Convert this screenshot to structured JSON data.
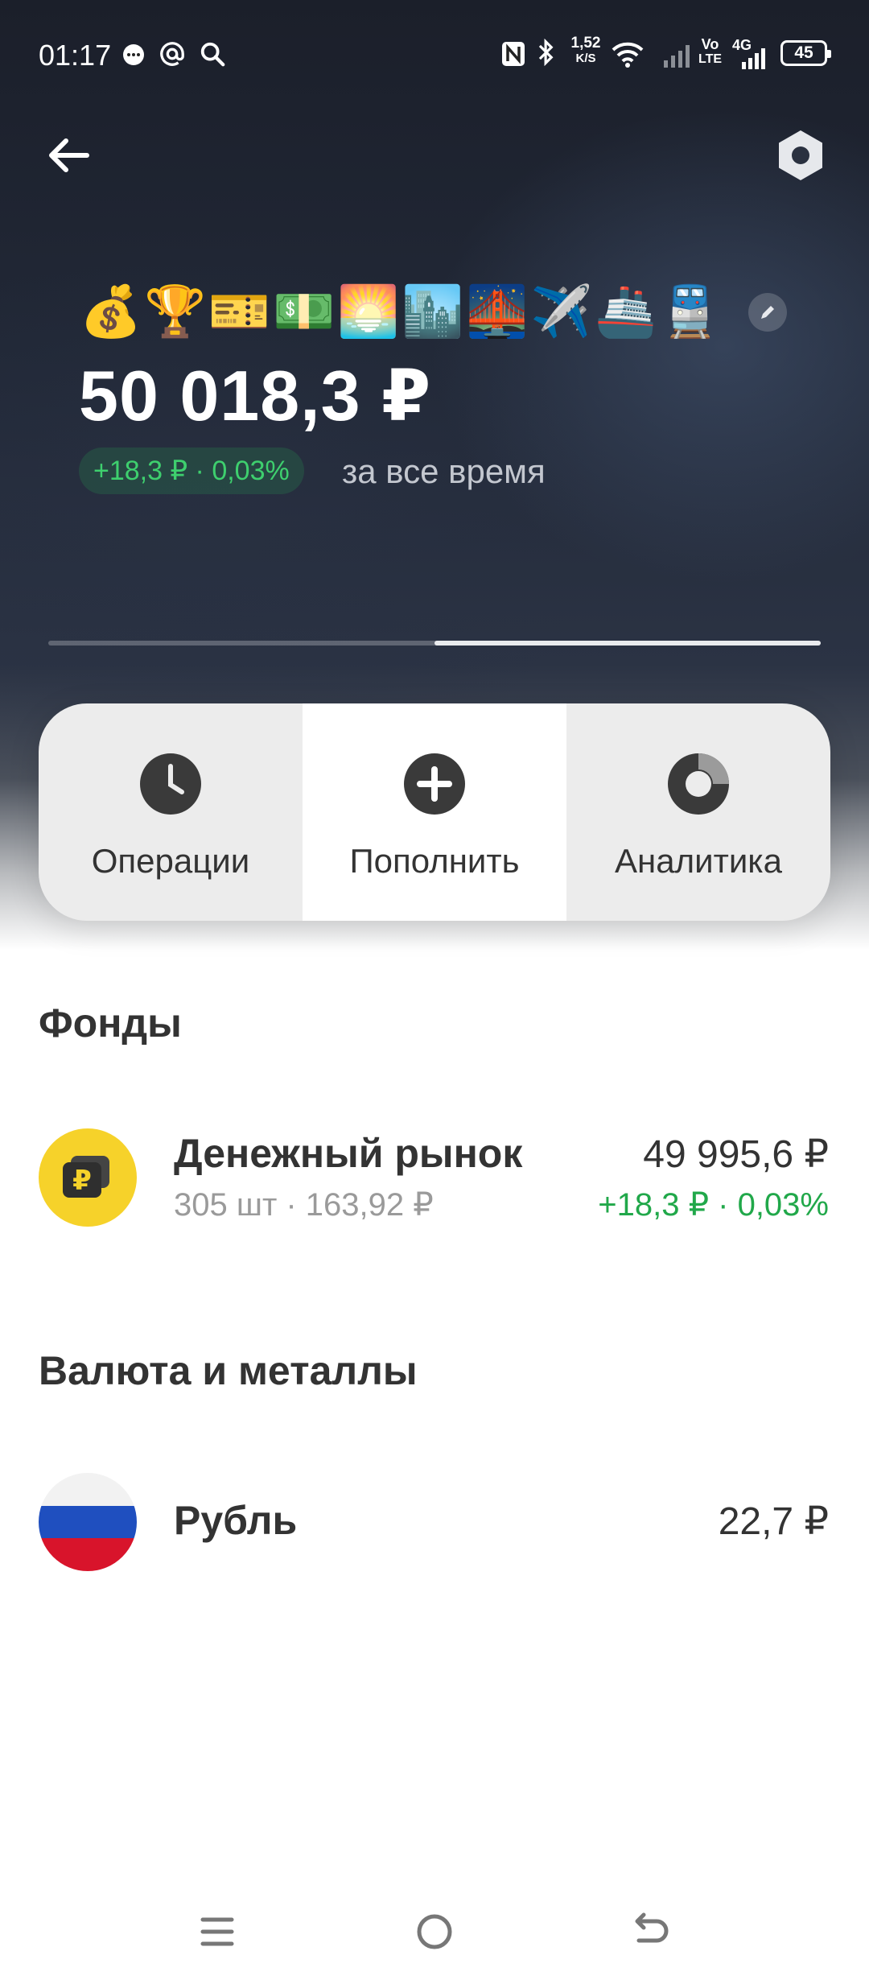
{
  "status_bar": {
    "time": "01:17",
    "net_speed_value": "1,52",
    "net_speed_unit": "K/S",
    "lte_top": "Vo",
    "lte_bottom": "LTE",
    "network": "4G",
    "battery": "45"
  },
  "portfolio": {
    "emojis": [
      "💰",
      "🏆",
      "🎫",
      "💵",
      "🌅",
      "🏙️",
      "🌉",
      "✈️",
      "🚢",
      "🚆"
    ],
    "balance": "50 018,3 ₽",
    "change": "+18,3 ₽ · 0,03%",
    "period": "за все время",
    "progress_fraction": 0.5
  },
  "actions": [
    {
      "label": "Операции",
      "icon": "clock-icon"
    },
    {
      "label": "Пополнить",
      "icon": "plus-icon"
    },
    {
      "label": "Аналитика",
      "icon": "donut-chart-icon"
    }
  ],
  "funds": {
    "title": "Фонды",
    "items": [
      {
        "name": "Денежный рынок",
        "sub": "305 шт · 163,92 ₽",
        "amount": "49 995,6 ₽",
        "change": "+18,3 ₽ · 0,03%"
      }
    ]
  },
  "currency": {
    "title": "Валюта и металлы",
    "items": [
      {
        "name": "Рубль",
        "amount": "22,7 ₽"
      }
    ]
  },
  "colors": {
    "positive": "#21a84a",
    "fund_logo": "#f6d22a"
  }
}
